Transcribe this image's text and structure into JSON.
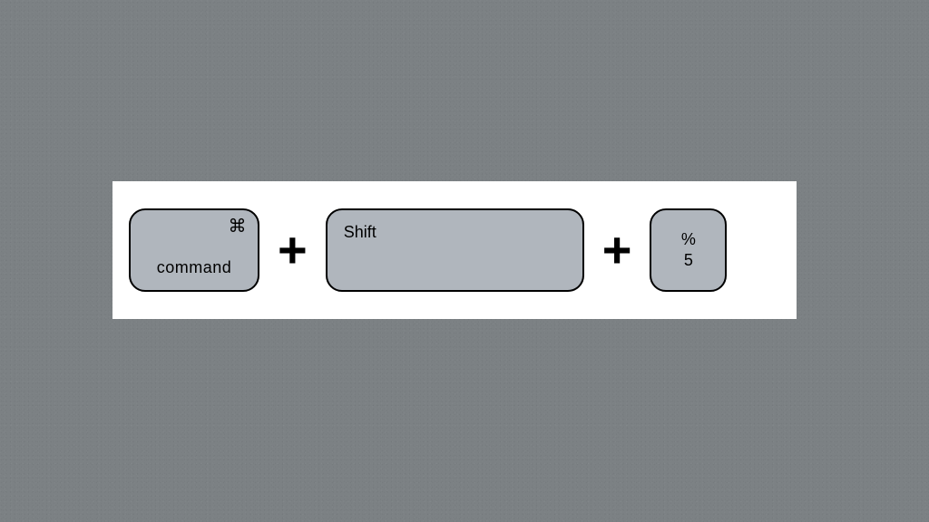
{
  "shortcut": {
    "keys": [
      {
        "label": "command",
        "symbol": "⌘"
      },
      {
        "label": "Shift"
      },
      {
        "upper": "%",
        "lower": "5"
      }
    ],
    "separator": "+"
  }
}
